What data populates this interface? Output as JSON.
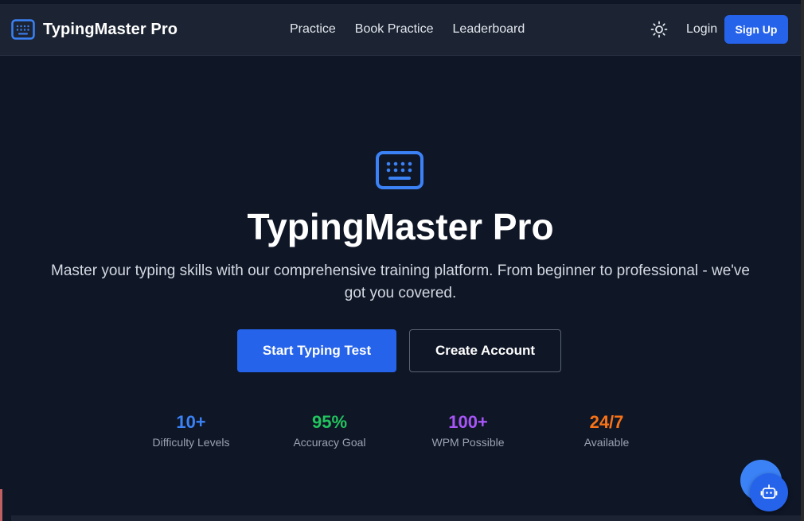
{
  "brand": {
    "name": "TypingMaster Pro",
    "icon": "keyboard-icon"
  },
  "nav": {
    "links": [
      "Practice",
      "Book Practice",
      "Leaderboard"
    ],
    "theme_icon": "sun-icon",
    "login_label": "Login",
    "signup_label": "Sign Up"
  },
  "hero": {
    "icon": "keyboard-icon",
    "title": "TypingMaster Pro",
    "subtitle": "Master your typing skills with our comprehensive training platform. From beginner to professional - we've got you covered.",
    "primary_label": "Start Typing Test",
    "secondary_label": "Create Account"
  },
  "stats": [
    {
      "value": "10+",
      "label": "Difficulty Levels",
      "color": "#3b82f6"
    },
    {
      "value": "95%",
      "label": "Accuracy Goal",
      "color": "#22c55e"
    },
    {
      "value": "100+",
      "label": "WPM Possible",
      "color": "#a855f7"
    },
    {
      "value": "24/7",
      "label": "Available",
      "color": "#f97316"
    }
  ],
  "chat": {
    "icon": "robot-icon"
  },
  "colors": {
    "accent": "#2563eb",
    "background": "#0f1626",
    "navbar": "#1c2433"
  }
}
